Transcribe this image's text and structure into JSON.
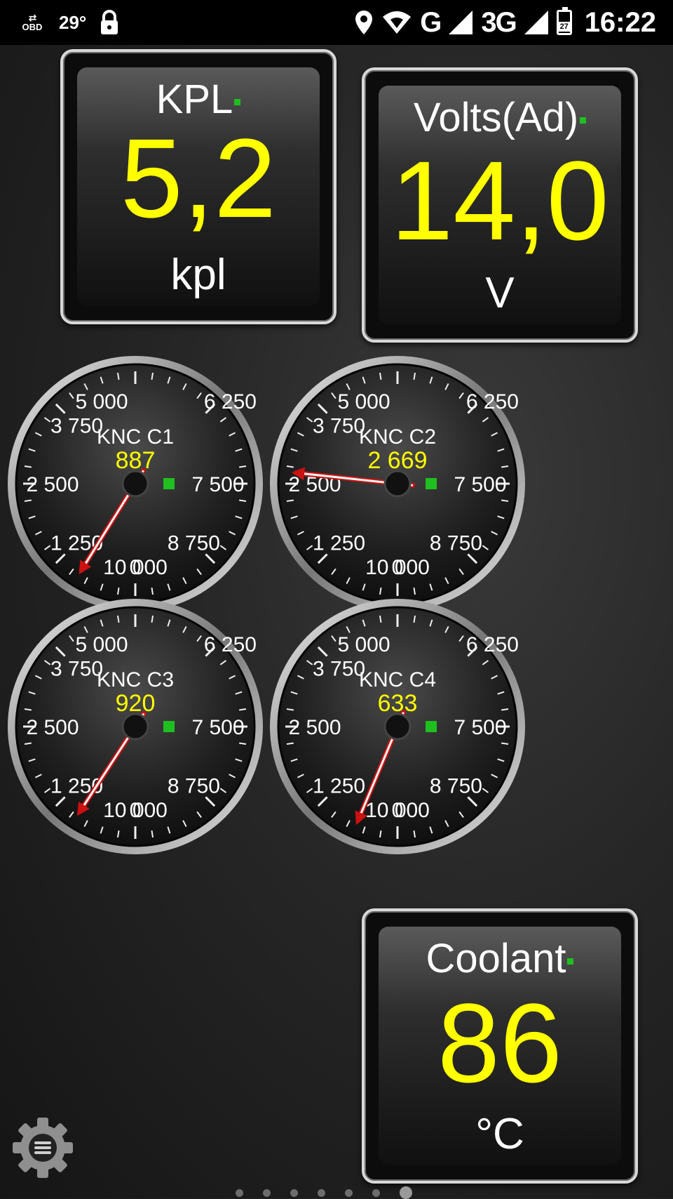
{
  "status_bar": {
    "obd_label": "OBD",
    "temperature": "29°",
    "network_g": "G",
    "network_3g": "3G",
    "battery_level": "27",
    "time": "16:22"
  },
  "tiles": {
    "kpl": {
      "label": "KPL",
      "value": "5,2",
      "unit": "kpl"
    },
    "volts": {
      "label": "Volts(Ad)",
      "value": "14,0",
      "unit": "V"
    },
    "coolant": {
      "label": "Coolant",
      "value": "86",
      "unit": "°C"
    }
  },
  "gauge_scale": [
    "0",
    "1 250",
    "2 500",
    "3 750",
    "5 000",
    "6 250",
    "7 500",
    "8 750",
    "10 000"
  ],
  "gauges": [
    {
      "label": "KNC C1",
      "value": "887",
      "reading": 887
    },
    {
      "label": "KNC C2",
      "value": "2 669",
      "reading": 2669
    },
    {
      "label": "KNC C3",
      "value": "920",
      "reading": 920
    },
    {
      "label": "KNC C4",
      "value": "633",
      "reading": 633
    }
  ],
  "gauge_range": [
    0,
    10000
  ],
  "pager": {
    "count": 7,
    "active_index": 6
  },
  "colors": {
    "value_text": "#ffff00",
    "status_led": "#1fbf1f",
    "needle": "#cc1111"
  }
}
